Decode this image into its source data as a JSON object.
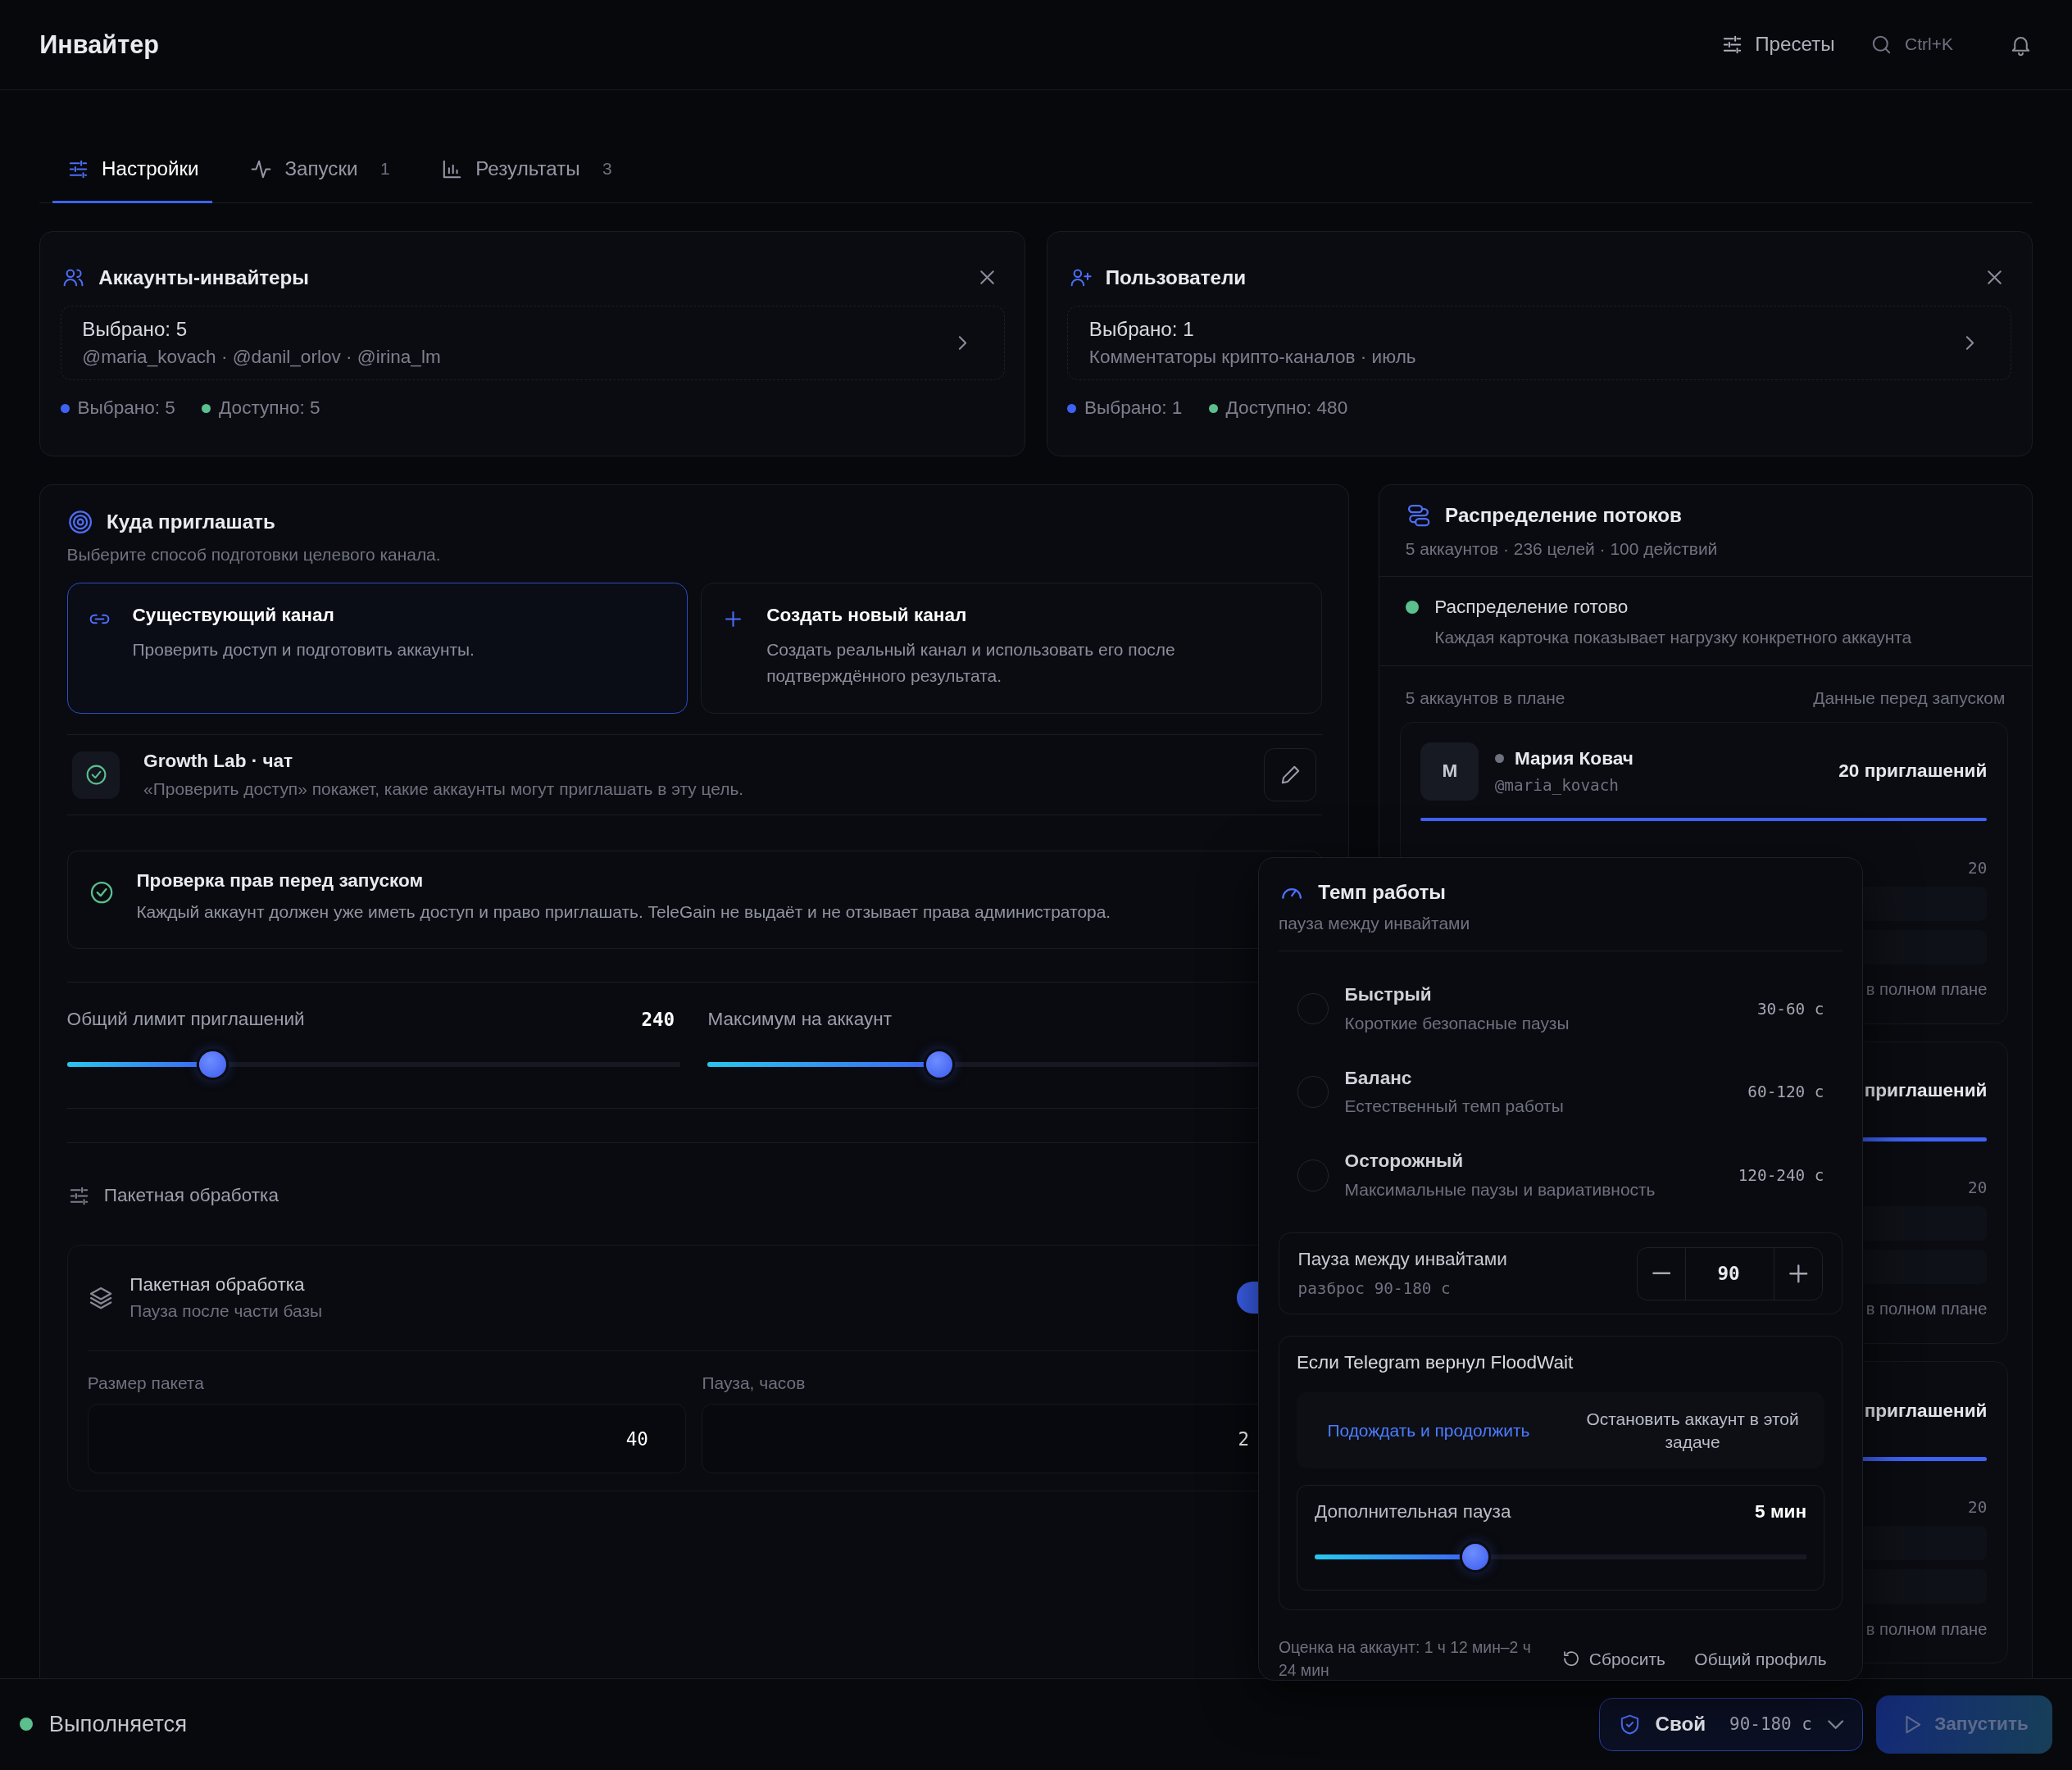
{
  "header": {
    "title": "Инвайтер",
    "presets_button": "Пресеты",
    "search_shortcut": "Ctrl+K"
  },
  "tabs": [
    {
      "label": "Настройки",
      "selected": true
    },
    {
      "label": "Запуски",
      "count": "1",
      "selected": false
    },
    {
      "label": "Результаты",
      "count": "3",
      "selected": false
    }
  ],
  "selectors": [
    {
      "title": "Аккаунты-инвайтеры",
      "value": "Выбрано: 5",
      "detail": "@maria_kovach · @danil_orlov · @irina_lm",
      "stats": [
        {
          "label": "Выбрано: 5",
          "color": "#3d63f5"
        },
        {
          "label": "Доступно: 5",
          "color": "#5bbf8e"
        }
      ]
    },
    {
      "title": "Пользователи",
      "value": "Выбрано: 1",
      "detail": "Комментаторы крипто-каналов · июль",
      "stats": [
        {
          "label": "Выбрано: 1",
          "color": "#3d63f5"
        },
        {
          "label": "Доступно: 480",
          "color": "#5bbf8e"
        }
      ]
    }
  ],
  "target": {
    "title": "Куда приглашать",
    "subtitle": "Выберите способ подготовки целевого канала.",
    "options": [
      {
        "title": "Существующий канал",
        "description": "Проверить доступ и подготовить аккаунты.",
        "selected": true
      },
      {
        "title": "Создать новый канал",
        "description": "Создать реальный канал и использовать его после подтверждённого результата.",
        "selected": false
      }
    ],
    "channel": {
      "name": "Growth Lab · чат",
      "hint": "«Проверить доступ» покажет, какие аккаунты могут приглашать в эту цель."
    },
    "rights_check": {
      "title": "Проверка прав перед запуском",
      "text": "Каждый аккаунт должен уже иметь доступ и право приглашать. TeleGain не выдаёт и не отзывает права администратора."
    },
    "sliders": [
      {
        "label": "Общий лимит приглашений",
        "value": "240",
        "level": 0.24
      },
      {
        "label": "Максимум на аккаунт",
        "level": 0.38
      }
    ],
    "batch": {
      "section_title": "Пакетная обработка",
      "title": "Пакетная обработка",
      "subtitle": "Пауза после части базы",
      "on": true,
      "fields": [
        {
          "label": "Размер пакета",
          "value": "40"
        },
        {
          "label": "Пауза, часов",
          "value": "2"
        }
      ]
    }
  },
  "distribution": {
    "title": "Распределение потоков",
    "subtitle": "5 аккаунтов · 236 целей · 100 действий",
    "status": {
      "title": "Распределение готово",
      "text": "Каждая карточка показывает нагрузку конкретного аккаунта"
    },
    "list_caption": "5 аккаунтов в плане",
    "list_note": "Данные перед запуском",
    "accounts": [
      {
        "initial": "М",
        "name": "Мария Ковач",
        "handle": "@maria_kovach",
        "invites": "20 приглашений",
        "level": 1,
        "count": "20",
        "footer": "в полном плане"
      },
      {
        "invites": "приглашений",
        "level": 1,
        "count": "20",
        "footer": "в полном плане"
      },
      {
        "invites": "приглашений",
        "level": 1,
        "count": "20",
        "footer": "в полном плане"
      }
    ]
  },
  "tempo": {
    "title": "Темп работы",
    "subtitle": "пауза между инвайтами",
    "modes": [
      {
        "title": "Быстрый",
        "description": "Короткие безопасные паузы",
        "range": "30-60 с",
        "selected": false
      },
      {
        "title": "Баланс",
        "description": "Естественный темп работы",
        "range": "60-120 с",
        "selected": false
      },
      {
        "title": "Осторожный",
        "description": "Максимальные паузы и вариативность",
        "range": "120-240 с",
        "selected": false
      }
    ],
    "pause": {
      "label": "Пауза между инвайтами",
      "hint": "разброс 90-180 с",
      "value": "90"
    },
    "floodwait": {
      "title": "Если Telegram вернул FloodWait",
      "options": [
        {
          "label": "Подождать и продолжить",
          "selected": true
        },
        {
          "label": "Остановить аккаунт в этой задаче",
          "selected": false
        }
      ],
      "extra": {
        "label": "Дополнительная пауза",
        "value": "5 мин",
        "level": 0.33
      }
    },
    "estimate": "Оценка на аккаунт: 1 ч 12 мин–2 ч 24 мин",
    "reset_button": "Сбросить",
    "profile_button": "Общий профиль"
  },
  "status_bar": {
    "status": "Выполняется",
    "profile": {
      "name": "Свой",
      "range": "90-180 с"
    },
    "run_button": {
      "label": "Запустить",
      "disabled": true
    }
  }
}
